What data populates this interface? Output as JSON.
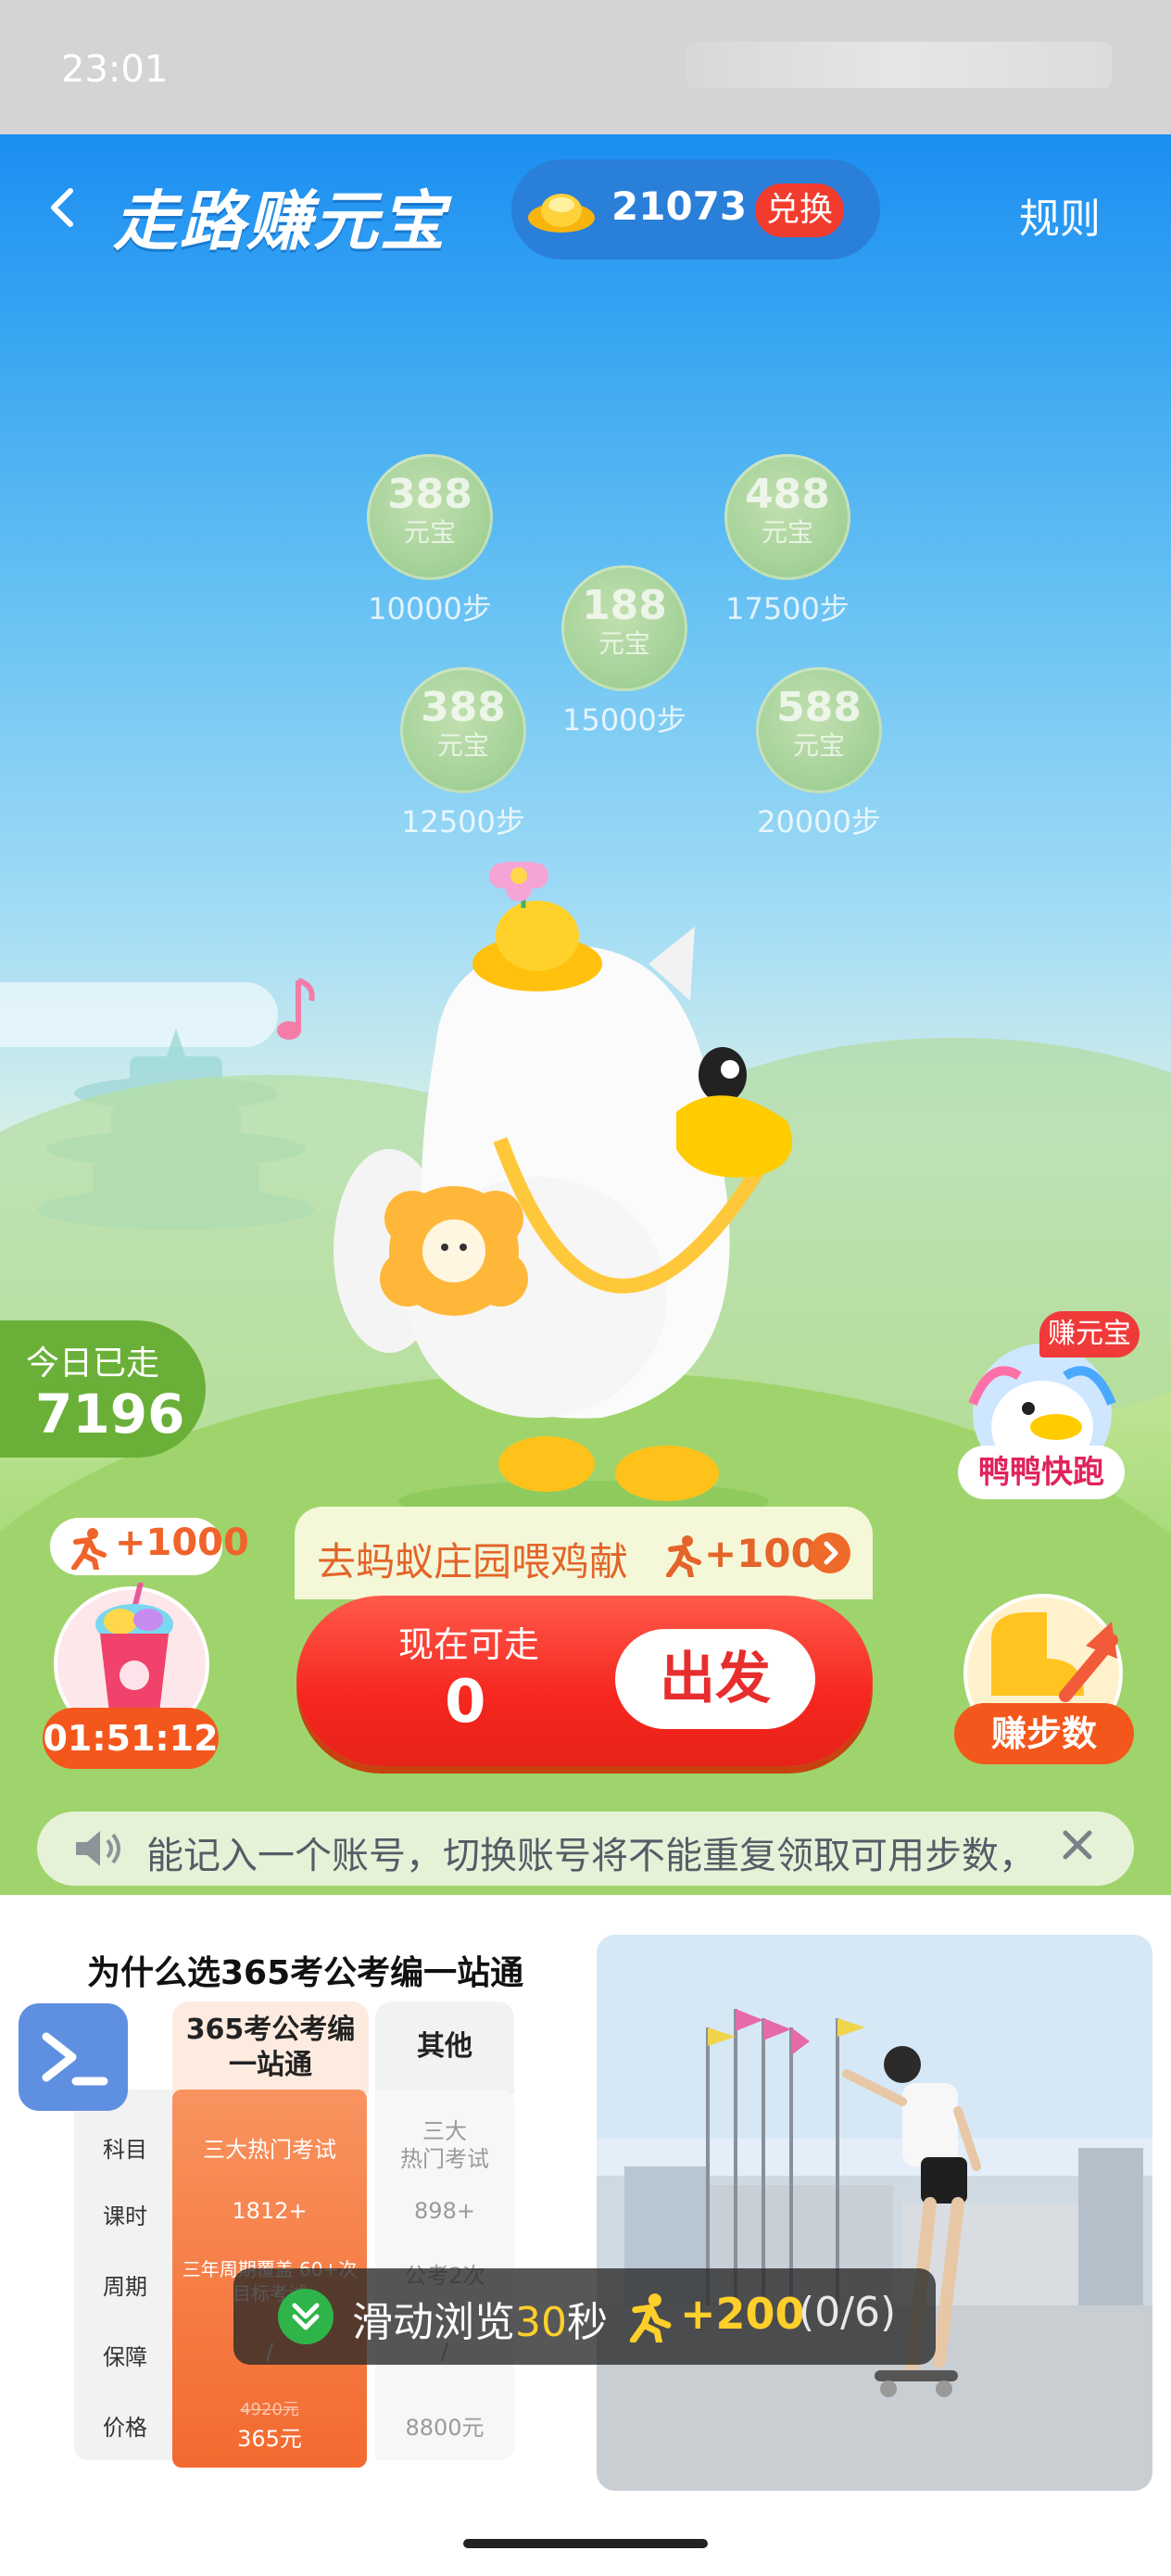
{
  "status_bar": {
    "time": "23:01"
  },
  "header": {
    "title": "走路赚元宝",
    "coin_count": "21073",
    "exchange_label": "兑换",
    "rules_label": "规则"
  },
  "bubbles": [
    {
      "amount": "388",
      "unit": "元宝",
      "steps": "10000步"
    },
    {
      "amount": "488",
      "unit": "元宝",
      "steps": "17500步"
    },
    {
      "amount": "188",
      "unit": "元宝",
      "steps": "15000步"
    },
    {
      "amount": "388",
      "unit": "元宝",
      "steps": "12500步"
    },
    {
      "amount": "588",
      "unit": "元宝",
      "steps": "20000步"
    }
  ],
  "today": {
    "label": "今日已走",
    "value": "7196"
  },
  "duck_run": {
    "badge": "赚元宝",
    "label": "鸭鸭快跑"
  },
  "left_reward": {
    "plus": "+1000",
    "timer": "01:51:12"
  },
  "task": {
    "text": "去蚂蚁庄园喂鸡献",
    "reward": "+100"
  },
  "walk": {
    "label": "现在可走",
    "value": "0",
    "go_label": "出发"
  },
  "earn_steps": {
    "label": "赚步数"
  },
  "notice": {
    "text": "能记入一个账号，切换账号将不能重复领取可用步数，"
  },
  "ad": {
    "title": "为什么选365考公考编一站通",
    "brand_head": [
      "365考公考编",
      "一站通"
    ],
    "other_head": "其他",
    "rows": [
      {
        "label": "科目",
        "ours": "三大热门考试",
        "other": [
          "三大",
          "热门考试"
        ]
      },
      {
        "label": "课时",
        "ours": "1812+",
        "other": [
          "898+"
        ]
      },
      {
        "label": "周期",
        "ours": "三年周期覆盖 60+次目标考试",
        "other": [
          "公考2次"
        ]
      },
      {
        "label": "保障",
        "ours": "/",
        "other": [
          "/"
        ]
      },
      {
        "label": "价格",
        "ours_old": "4920元",
        "ours": "365元",
        "other": [
          "8800元"
        ]
      }
    ]
  },
  "toast": {
    "prefix": "滑动浏览",
    "highlight": "30",
    "suffix": "秒",
    "reward": "+200",
    "progress": "(0/6)"
  },
  "colors": {
    "accent_red": "#f23c2e",
    "accent_orange": "#f4571c",
    "sky_blue": "#1c8ef2",
    "grass_green": "#9fd46c"
  }
}
